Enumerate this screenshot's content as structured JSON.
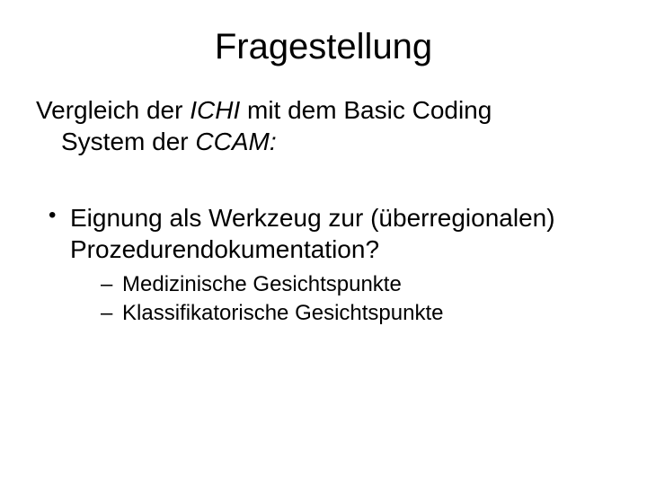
{
  "slide": {
    "title": "Fragestellung",
    "intro_line1": "Vergleich der ",
    "intro_term1": "ICHI",
    "intro_mid": " mit dem Basic Coding",
    "intro_line2a": "System der ",
    "intro_term2": "CCAM:",
    "bullets": [
      {
        "line1": "Eignung als Werkzeug zur (überregionalen)",
        "line2": "Prozedurendokumentation?",
        "sub": [
          "Medizinische Gesichtspunkte",
          "Klassifikatorische Gesichtspunkte"
        ]
      }
    ]
  }
}
